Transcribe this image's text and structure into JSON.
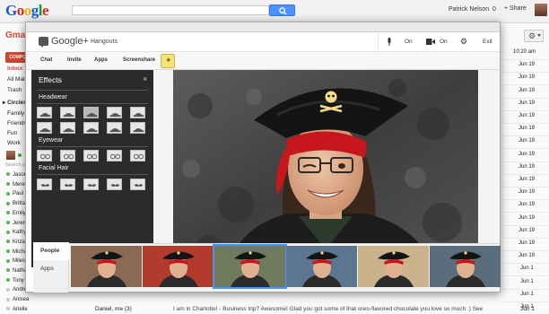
{
  "google": {
    "logo": "Google",
    "user_name": "Patrick Nelson",
    "notification_count": "0",
    "share_label": "+ Share"
  },
  "gmail": {
    "label": "Gmail",
    "compose_label": "COMPOSE",
    "nav": [
      "Inbox",
      "All Mail",
      "Trash"
    ],
    "circles_label": "Circles",
    "circles": [
      "Family",
      "Friends",
      "Fun",
      "Work"
    ],
    "chat_search_placeholder": "Search people...",
    "contacts": [
      "Jason",
      "Meredith",
      "Paul",
      "Brittany",
      "Emily",
      "Jeremy",
      "Kathy",
      "Krizia",
      "Michael",
      "Miles",
      "Nathaniel",
      "Tony",
      "Andrew",
      "Anisea",
      "Arielle"
    ],
    "dates": [
      "10:20 am",
      "Jun 19",
      "Jun 19",
      "Jun 19",
      "Jun 19",
      "Jun 19",
      "Jun 19",
      "Jun 19",
      "Jun 19",
      "Jun 19",
      "Jun 19",
      "Jun 19",
      "Jun 19",
      "Jun 19",
      "Jun 19",
      "Jun 19",
      "Jun 19",
      "Jun 1",
      "Jun 1",
      "Jun 1",
      "Jun 1"
    ],
    "email": {
      "sender": "Daniel, me (3)",
      "snippet": "I am in Charlotte! - Business trip? Awesome! Glad you got some of that oreo-flavored chocolate you love so much :) See",
      "date": "Jun 1"
    }
  },
  "hangout": {
    "brand": "Google+",
    "subtitle": "Hangouts",
    "mic_label": "On",
    "camera_label": "On",
    "exit_label": "Exit",
    "tabs": [
      "Chat",
      "Invite",
      "Apps",
      "Screenshare"
    ],
    "effects": {
      "title": "Effects",
      "close": "×",
      "sections": [
        "Headwear",
        "Eyewear",
        "Facial Hair"
      ]
    },
    "side_tabs": {
      "people": "People",
      "apps": "Apps"
    },
    "participant_count": 6,
    "active_participant": 3
  },
  "colors": {
    "accent_blue": "#4d90fe",
    "gmail_red": "#dd4b39",
    "pirate_red": "#c8161d",
    "panel_dark": "#2b2b2b"
  }
}
